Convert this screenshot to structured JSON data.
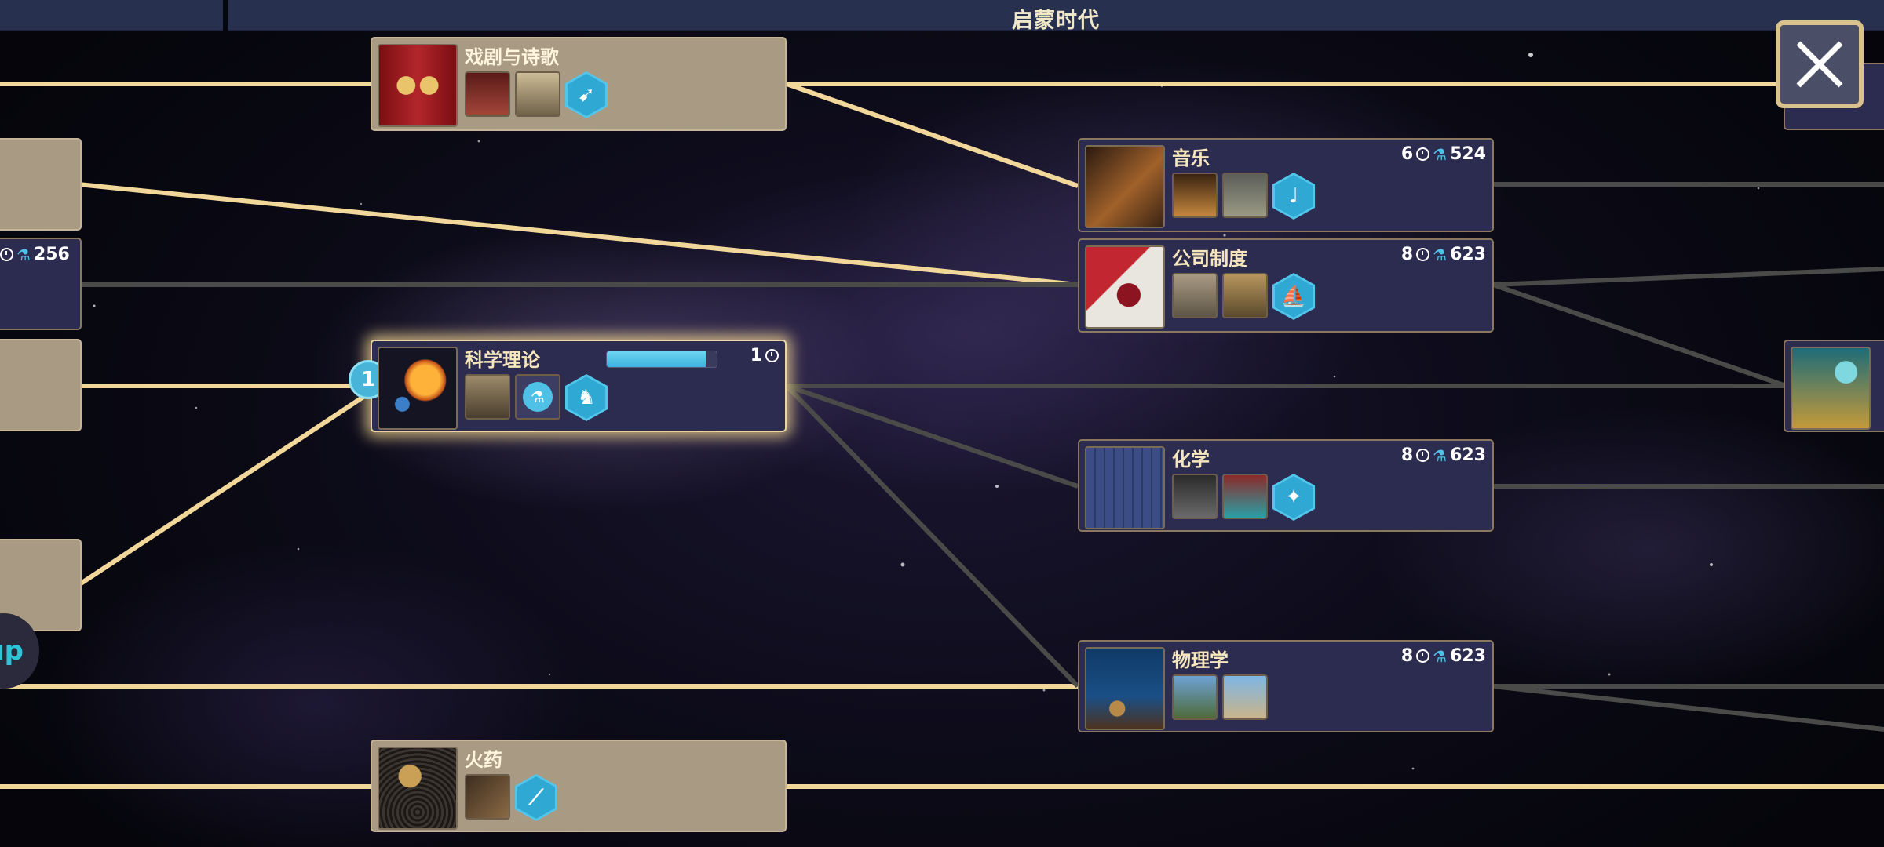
{
  "era": {
    "title": "启蒙时代"
  },
  "colors": {
    "connector_active": "#f2d79a",
    "connector_inactive": "#4a4a48",
    "science_blue": "#4fc0e6",
    "node_done_bg": "#a99a83",
    "node_open_bg": "#2c2b50"
  },
  "nodes": {
    "drama_poetry": {
      "name": "戏剧与诗歌",
      "state": "researched"
    },
    "music": {
      "name": "音乐",
      "turns": "6",
      "science": "524",
      "state": "available"
    },
    "corporation": {
      "name": "公司制度",
      "turns": "8",
      "science": "623",
      "state": "available"
    },
    "scientific_theory": {
      "name": "科学理论",
      "turns": "1",
      "queue_position": "1",
      "progress": 0.9,
      "state": "researching"
    },
    "chemistry": {
      "name": "化学",
      "turns": "8",
      "science": "623",
      "state": "available"
    },
    "physics": {
      "name": "物理学",
      "turns": "8",
      "science": "623",
      "state": "available"
    },
    "gunpowder": {
      "name": "火药",
      "state": "researched"
    },
    "left_stub": {
      "science": "256"
    }
  },
  "left_tab": {
    "label": "ıp"
  },
  "icons": [
    "close-icon",
    "clock-icon",
    "science-icon",
    "unit-hex-icon"
  ]
}
